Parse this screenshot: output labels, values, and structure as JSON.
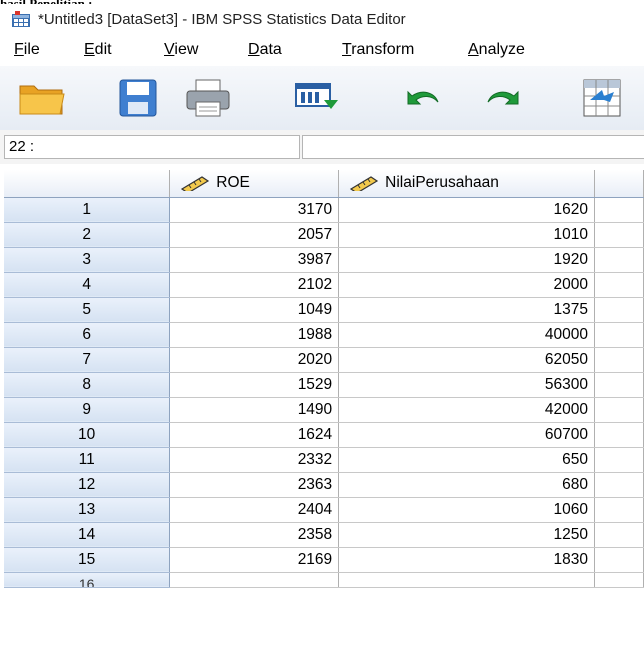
{
  "top_cut_text": "hasil Penelitian :",
  "window": {
    "title": "*Untitled3 [DataSet3] - IBM SPSS Statistics Data Editor"
  },
  "menu": [
    {
      "pre": "",
      "ul": "F",
      "post": "ile"
    },
    {
      "pre": "",
      "ul": "E",
      "post": "dit"
    },
    {
      "pre": "",
      "ul": "V",
      "post": "iew"
    },
    {
      "pre": "",
      "ul": "D",
      "post": "ata"
    },
    {
      "pre": "",
      "ul": "T",
      "post": "ransform"
    },
    {
      "pre": "",
      "ul": "A",
      "post": "nalyze"
    }
  ],
  "toolbar": {
    "icons": [
      "open-folder-icon",
      "save-icon",
      "print-icon",
      "dialog-recall-icon",
      "undo-icon",
      "redo-icon",
      "goto-case-icon"
    ]
  },
  "cell_editor": {
    "reference": "22 :",
    "value": ""
  },
  "grid": {
    "columns": [
      "ROE",
      "NilaiPerusahaan"
    ],
    "rows": [
      {
        "id": "1",
        "roe": "3170",
        "nilai": "1620"
      },
      {
        "id": "2",
        "roe": "2057",
        "nilai": "1010"
      },
      {
        "id": "3",
        "roe": "3987",
        "nilai": "1920"
      },
      {
        "id": "4",
        "roe": "2102",
        "nilai": "2000"
      },
      {
        "id": "5",
        "roe": "1049",
        "nilai": "1375"
      },
      {
        "id": "6",
        "roe": "1988",
        "nilai": "40000"
      },
      {
        "id": "7",
        "roe": "2020",
        "nilai": "62050"
      },
      {
        "id": "8",
        "roe": "1529",
        "nilai": "56300"
      },
      {
        "id": "9",
        "roe": "1490",
        "nilai": "42000"
      },
      {
        "id": "10",
        "roe": "1624",
        "nilai": "60700"
      },
      {
        "id": "11",
        "roe": "2332",
        "nilai": "650"
      },
      {
        "id": "12",
        "roe": "2363",
        "nilai": "680"
      },
      {
        "id": "13",
        "roe": "2404",
        "nilai": "1060"
      },
      {
        "id": "14",
        "roe": "2358",
        "nilai": "1250"
      },
      {
        "id": "15",
        "roe": "2169",
        "nilai": "1830"
      }
    ],
    "partial_row": "16"
  }
}
